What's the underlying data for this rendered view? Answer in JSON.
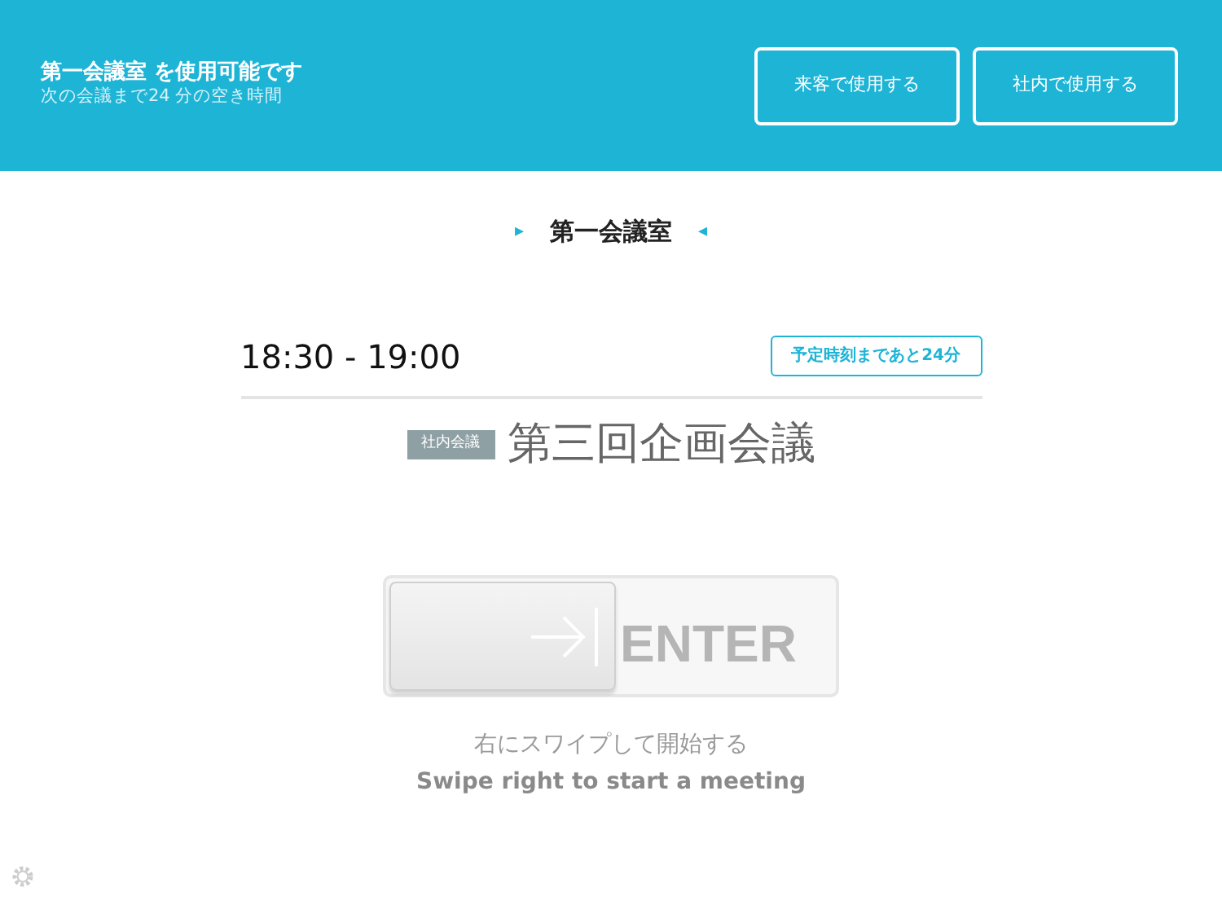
{
  "header": {
    "title": "第一会議室 を使用可能です",
    "subtitle": "次の会議まで24 分の空き時間",
    "buttons": [
      "来客で使用する",
      "社内で使用する"
    ]
  },
  "room": {
    "name": "第一会議室",
    "prev_arrow": "▸",
    "next_arrow": "◂"
  },
  "meeting": {
    "time": "18:30 - 19:00",
    "countdown": "予定時刻まであと24分",
    "category": "社内会議",
    "title": "第三回企画会議"
  },
  "slider": {
    "label": "ENTER",
    "level": 0,
    "hint": "右にスワイプして開始する",
    "hint_en": "Swipe right to start a meeting"
  }
}
